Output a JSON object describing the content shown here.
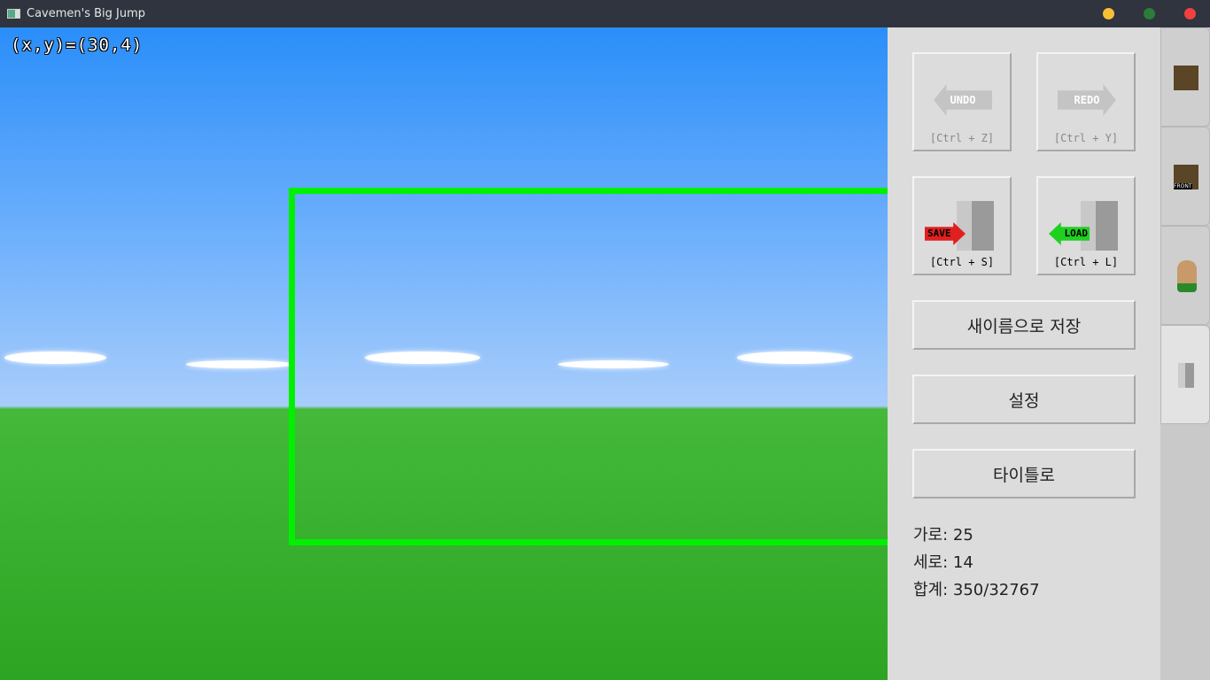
{
  "window": {
    "title": "Cavemen's Big Jump",
    "controls": {
      "minimize": "#f7c034",
      "maximize": "#2c7c3a",
      "close": "#f04040"
    }
  },
  "game": {
    "coordinate_readout": "(x,y)=(30,4)",
    "selection_color": "#00f000"
  },
  "panel": {
    "undo": {
      "label": "UNDO",
      "shortcut": "[Ctrl + Z]",
      "enabled": false
    },
    "redo": {
      "label": "REDO",
      "shortcut": "[Ctrl + Y]",
      "enabled": false
    },
    "save": {
      "label": "SAVE",
      "shortcut": "[Ctrl + S]",
      "color": "#e02020"
    },
    "load": {
      "label": "LOAD",
      "shortcut": "[Ctrl + L]",
      "color": "#20d020"
    },
    "save_as": "새이름으로 저장",
    "settings": "설정",
    "to_title": "타이틀로",
    "info": {
      "width": "가로: 25",
      "height": "세로: 14",
      "total": "합계: 350/32767"
    }
  },
  "tabs": [
    {
      "icon": "dirt-tile-icon"
    },
    {
      "icon": "dirt-front-tile-icon",
      "label": "FRONT"
    },
    {
      "icon": "caveman-icon"
    },
    {
      "icon": "computer-icon",
      "active": true
    }
  ]
}
